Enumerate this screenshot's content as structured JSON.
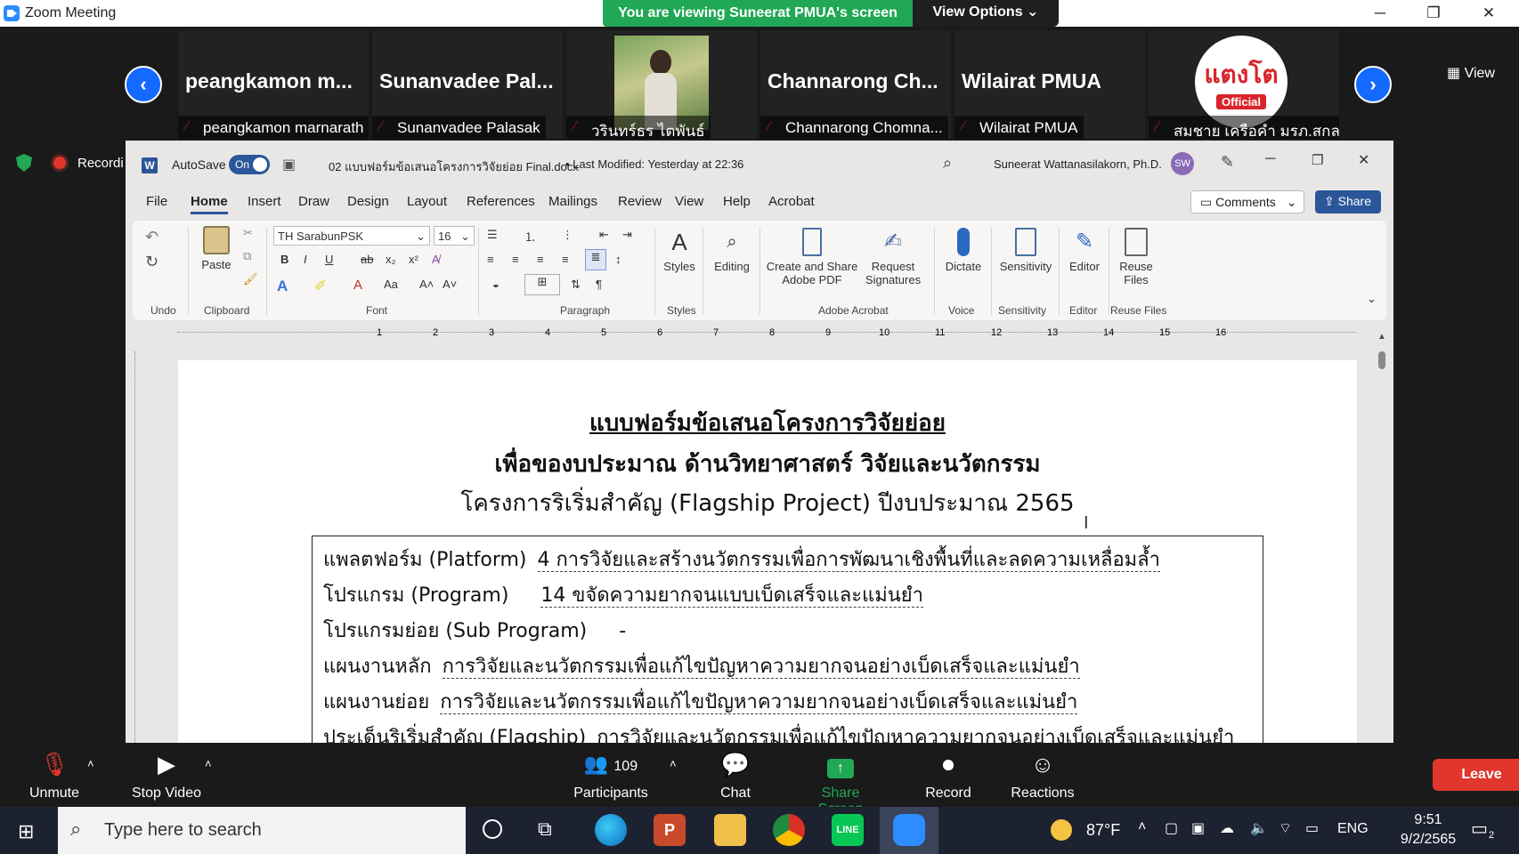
{
  "zoom": {
    "title": "Zoom Meeting",
    "banner": "You are viewing Suneerat PMUA's screen",
    "view_options": "View Options ⌄",
    "view_button": "View",
    "recording": "Recordi",
    "participants_count": "109"
  },
  "gallery": {
    "tiles": [
      {
        "name": "peangkamon  m...",
        "label": "peangkamon marnarath"
      },
      {
        "name": "Sunanvadee  Pal...",
        "label": "Sunanvadee Palasak"
      },
      {
        "name": "",
        "label": "วรินทร์ธร ไตพันธ์"
      },
      {
        "name": "Channarong  Ch...",
        "label": "Channarong Chomna..."
      },
      {
        "name": "Wilairat PMUA",
        "label": "Wilairat PMUA"
      },
      {
        "name": "",
        "label": "สมชาย เครือคำ มรภ.สกลน..."
      }
    ],
    "logo_text": "แตงโต",
    "logo_sub": "Official"
  },
  "word": {
    "autosave_label": "AutoSave",
    "autosave_state": "On",
    "file_name": "02 แบบฟอร์มข้อเสนอโครงการวิจัยย่อย Final.docx",
    "last_modified": "• Last Modified: Yesterday at 22:36",
    "user_name": "Suneerat Wattanasilakorn, Ph.D.",
    "user_initials": "SW",
    "tabs": [
      "File",
      "Home",
      "Insert",
      "Draw",
      "Design",
      "Layout",
      "References",
      "Mailings",
      "Review",
      "View",
      "Help",
      "Acrobat"
    ],
    "comments_label": "Comments",
    "share_label": "Share",
    "font_name": "TH SarabunPSK",
    "font_size": "16",
    "groups": {
      "undo": "Undo",
      "clipboard": "Clipboard",
      "font": "Font",
      "paragraph": "Paragraph",
      "styles": "Styles",
      "adobe": "Adobe Acrobat",
      "voice": "Voice",
      "sensitivity": "Sensitivity",
      "editor": "Editor",
      "reuse": "Reuse Files"
    },
    "buttons": {
      "paste": "Paste",
      "styles": "Styles",
      "editing": "Editing",
      "create_share_1": "Create and Share",
      "create_share_2": "Adobe PDF",
      "request_1": "Request",
      "request_2": "Signatures",
      "dictate": "Dictate",
      "sensitivity": "Sensitivity",
      "editor": "Editor",
      "reuse_1": "Reuse",
      "reuse_2": "Files"
    },
    "ruler_numbers": [
      "1",
      "2",
      "3",
      "4",
      "5",
      "6",
      "7",
      "8",
      "9",
      "10",
      "11",
      "12",
      "13",
      "14",
      "15",
      "16"
    ]
  },
  "document": {
    "title1": "แบบฟอร์มข้อเสนอโครงการวิจัยย่อย",
    "title2": "เพื่อของบประมาณ ด้านวิทยาศาสตร์ วิจัยและนวัตกรรม",
    "title3": "โครงการริเริ่มสำคัญ (Flagship Project) ปีงบประมาณ 2565",
    "rows": [
      {
        "label": "แพลตฟอร์ม (Platform)",
        "value": "4 การวิจัยและสร้างนวัตกรรมเพื่อการพัฒนาเชิงพื้นที่และลดความเหลื่อมล้ำ"
      },
      {
        "label": "โปรแกรม (Program)",
        "value": "14 ขจัดความยากจนแบบเบ็ดเสร็จและแม่นยำ"
      },
      {
        "label": "โปรแกรมย่อย (Sub Program)",
        "value": "-"
      },
      {
        "label": "แผนงานหลัก",
        "value": "การวิจัยและนวัตกรรมเพื่อแก้ไขปัญหาความยากจนอย่างเบ็ดเสร็จและแม่นยำ"
      },
      {
        "label": "แผนงานย่อย",
        "value": "การวิจัยและนวัตกรรมเพื่อแก้ไขปัญหาความยากจนอย่างเบ็ดเสร็จและแม่นยำ"
      },
      {
        "label": "ประเด็นริเริ่มสำคัญ (Flagship)",
        "value": "การวิจัยและนวัตกรรมเพื่อแก้ไขปัญหาความยากจนอย่างเบ็ดเสร็จและแม่นยำ"
      }
    ]
  },
  "controls": {
    "unmute": "Unmute",
    "stop_video": "Stop Video",
    "participants": "Participants",
    "chat": "Chat",
    "share_screen": "Share Screen",
    "record": "Record",
    "reactions": "Reactions",
    "leave": "Leave"
  },
  "taskbar": {
    "search_placeholder": "Type here to search",
    "temperature": "87°F",
    "language": "ENG",
    "time": "9:51",
    "date": "9/2/2565",
    "notification_count": "2"
  },
  "colors": {
    "zoom_green": "#21a856",
    "zoom_blue": "#1469ff",
    "word_blue": "#2b579a",
    "leave_red": "#e0362d"
  }
}
